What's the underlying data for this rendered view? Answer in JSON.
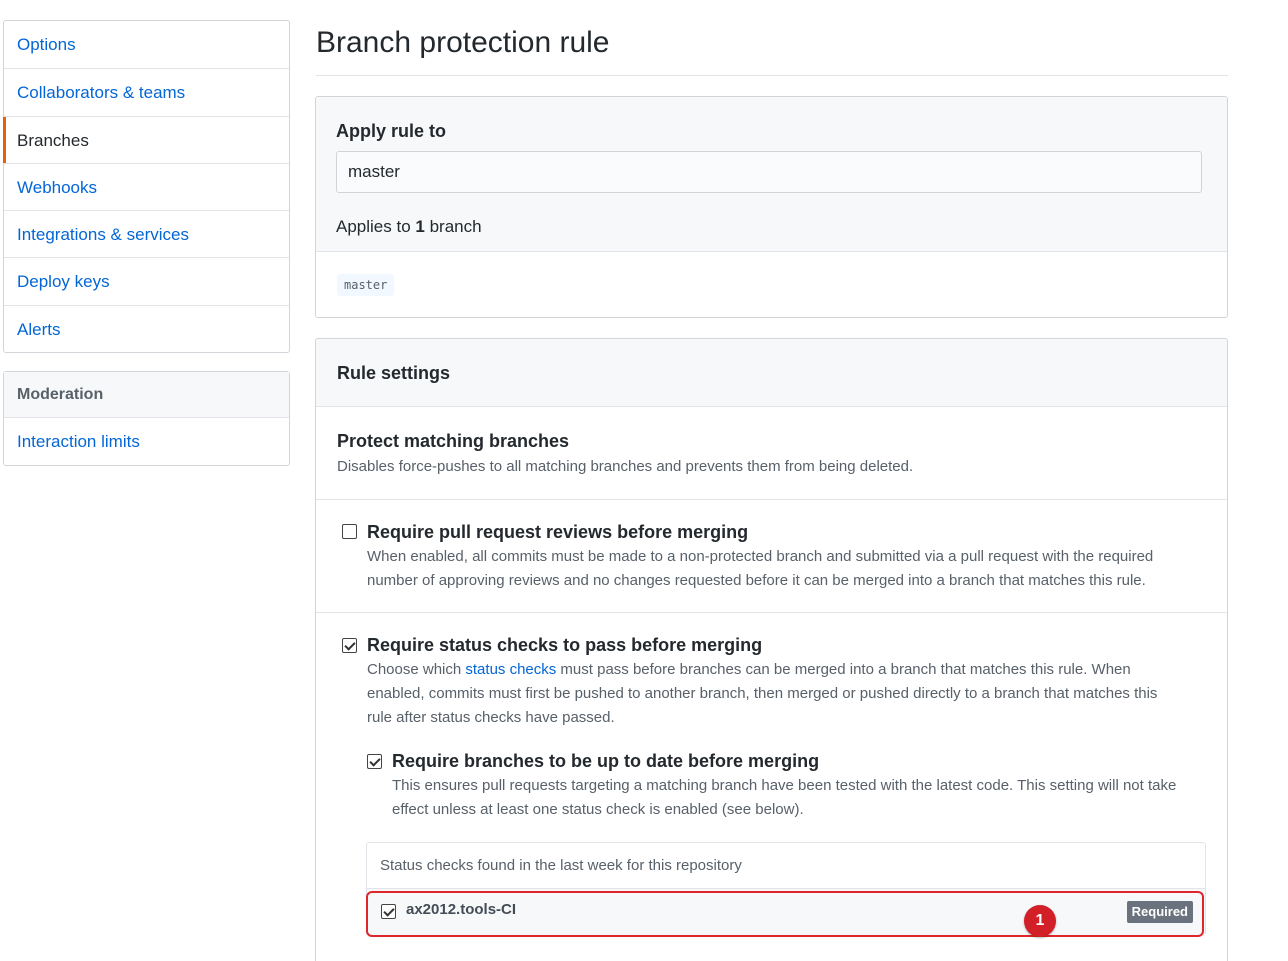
{
  "sidebar": {
    "items": [
      {
        "label": "Options"
      },
      {
        "label": "Collaborators & teams"
      },
      {
        "label": "Branches"
      },
      {
        "label": "Webhooks"
      },
      {
        "label": "Integrations & services"
      },
      {
        "label": "Deploy keys"
      },
      {
        "label": "Alerts"
      }
    ],
    "moderation": {
      "heading": "Moderation",
      "items": [
        {
          "label": "Interaction limits"
        }
      ]
    }
  },
  "page": {
    "title": "Branch protection rule"
  },
  "apply": {
    "label": "Apply rule to",
    "pattern_value": "master",
    "applies_prefix": "Applies to ",
    "applies_count": "1",
    "applies_suffix": " branch",
    "matched_branch": "master"
  },
  "rules": {
    "heading": "Rule settings",
    "protect": {
      "title": "Protect matching branches",
      "desc": "Disables force-pushes to all matching branches and prevents them from being deleted."
    },
    "reviews": {
      "checked": false,
      "title": "Require pull request reviews before merging",
      "desc_line1": "When enabled, all commits must be made to a non-protected branch and submitted via a pull request with the required",
      "desc_line2": "number of approving reviews and no changes requested before it can be merged into a branch that matches this rule."
    },
    "status": {
      "checked": true,
      "title": "Require status checks to pass before merging",
      "desc_prefix": "Choose which ",
      "desc_link": "status checks",
      "desc_rest1": " must pass before branches can be merged into a branch that matches this rule. When",
      "desc_line2": "enabled, commits must first be pushed to another branch, then merged or pushed directly to a branch that matches this",
      "desc_line3": "rule after status checks have passed.",
      "up_to_date": {
        "checked": true,
        "title": "Require branches to be up to date before merging",
        "desc_line1": "This ensures pull requests targeting a matching branch have been tested with the latest code. This setting will not take",
        "desc_line2": "effect unless at least one status check is enabled (see below)."
      },
      "checks": {
        "heading": "Status checks found in the last week for this repository",
        "items": [
          {
            "name": "ax2012.tools-CI",
            "checked": true,
            "badge": "Required"
          }
        ]
      }
    }
  },
  "annotation": {
    "marker": "1",
    "color": "#e0262a"
  }
}
